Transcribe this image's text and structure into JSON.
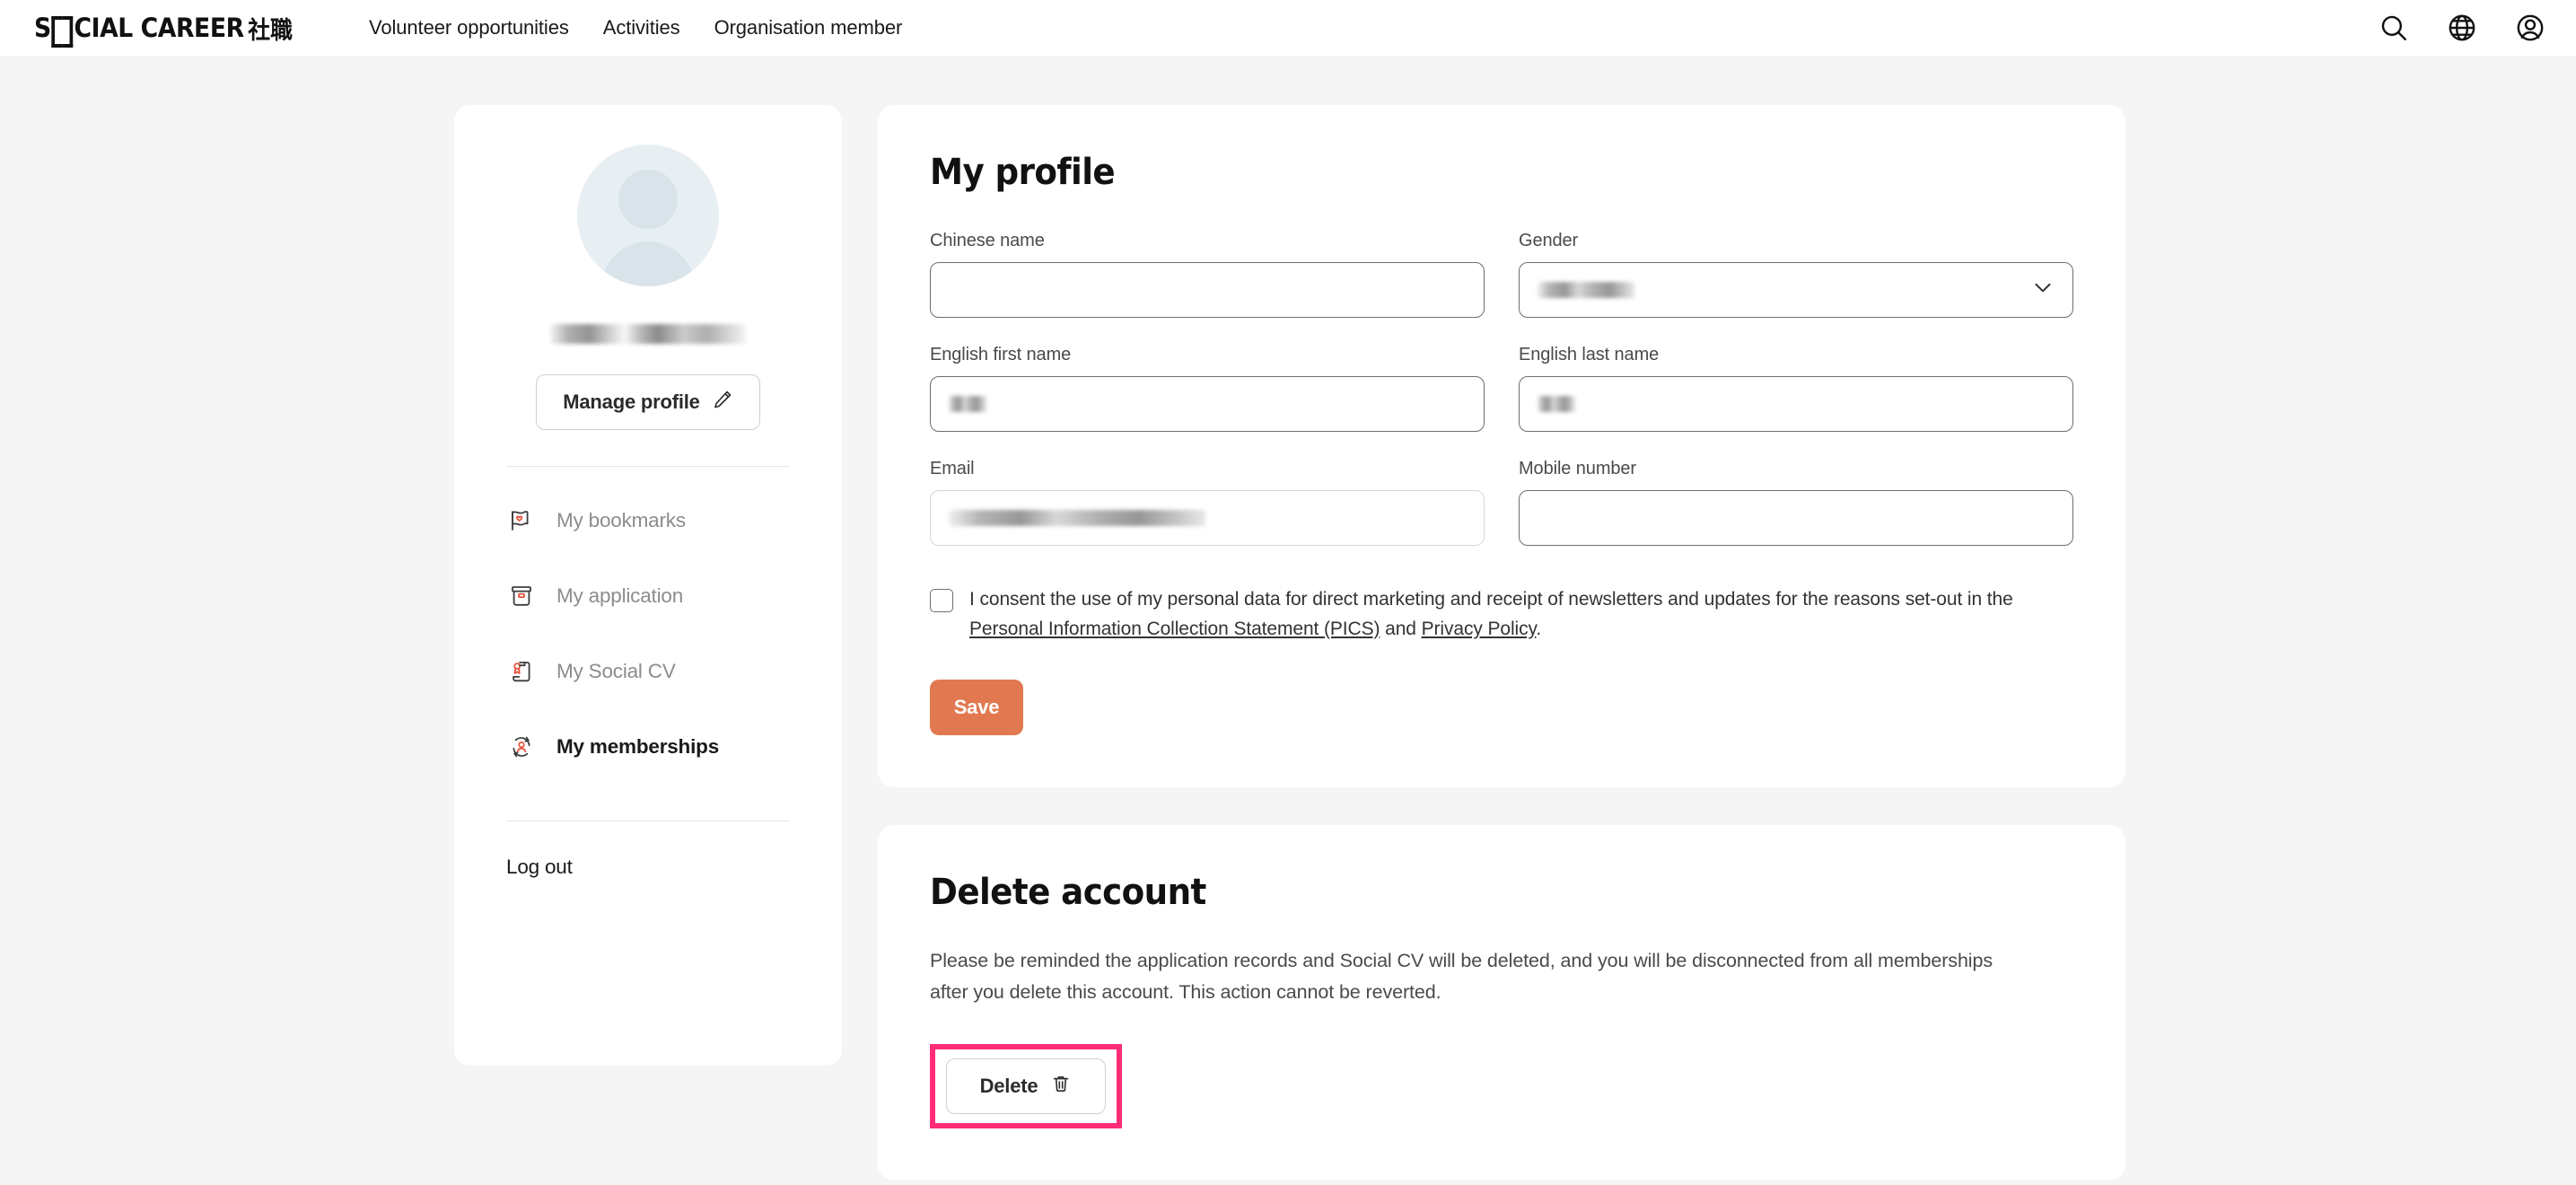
{
  "header": {
    "logo_text_a": "S",
    "logo_text_b": "CIAL CAREER",
    "logo_cjk": "社職",
    "nav": [
      {
        "label": "Volunteer opportunities"
      },
      {
        "label": "Activities"
      },
      {
        "label": "Organisation member"
      }
    ],
    "icons": [
      {
        "name": "search-icon"
      },
      {
        "name": "globe-icon"
      },
      {
        "name": "account-icon"
      }
    ]
  },
  "sidebar": {
    "username_redacted": true,
    "manage_profile_label": "Manage profile",
    "items": [
      {
        "label": "My bookmarks",
        "icon": "bookmark-flag-icon",
        "active": false
      },
      {
        "label": "My application",
        "icon": "archive-box-icon",
        "active": false
      },
      {
        "label": "My Social CV",
        "icon": "certificate-scroll-icon",
        "active": false
      },
      {
        "label": "My memberships",
        "icon": "membership-refresh-icon",
        "active": true
      }
    ],
    "logout_label": "Log out"
  },
  "profile": {
    "title": "My profile",
    "fields": {
      "chinese_name": {
        "label": "Chinese name",
        "value": ""
      },
      "gender": {
        "label": "Gender",
        "value": "",
        "redacted": true
      },
      "english_first_name": {
        "label": "English first name",
        "value": "",
        "redacted": true
      },
      "english_last_name": {
        "label": "English last name",
        "value": "",
        "redacted": true
      },
      "email": {
        "label": "Email",
        "value": "",
        "redacted": true,
        "disabled": true
      },
      "mobile_number": {
        "label": "Mobile number",
        "value": ""
      }
    },
    "consent": {
      "checked": false,
      "text_part1": "I consent the use of my personal data for direct marketing and receipt of newsletters and updates for the reasons set-out in the ",
      "link1": "Personal Information Collection Statement (PICS)",
      "text_part2": " and ",
      "link2": "Privacy Policy",
      "text_part3": "."
    },
    "save_label": "Save"
  },
  "delete_account": {
    "title": "Delete account",
    "description": "Please be reminded the application records and Social CV will be deleted, and you will be disconnected from all memberships after you delete this account. This action cannot be reverted.",
    "delete_label": "Delete",
    "highlighted": true
  },
  "colors": {
    "page_background": "#f5f5f5",
    "card_background": "#ffffff",
    "accent_orange": "#e1784f",
    "icon_accent": "#e8543c",
    "highlight_pink": "#ff2d78",
    "avatar_background": "#e7eff3"
  }
}
